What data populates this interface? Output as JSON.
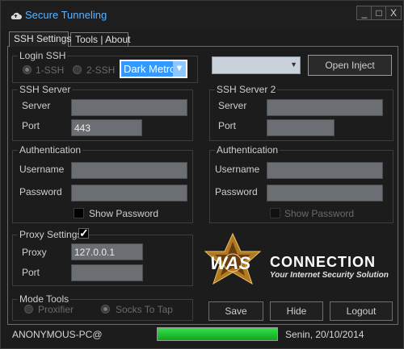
{
  "window": {
    "title": "Secure Tunneling",
    "minimize_label": "_",
    "maximize_label": "□",
    "close_label": "X"
  },
  "tabs": [
    {
      "label": "SSH Settings",
      "active": true
    },
    {
      "label": "Tools | About",
      "active": false
    }
  ],
  "login_ssh": {
    "legend": "Login SSH",
    "option1": "1-SSH",
    "option2": "2-SSH",
    "theme_value": "Dark Metro"
  },
  "open_inject": {
    "dropdown_value": "",
    "button_label": "Open Inject"
  },
  "ssh_server": {
    "legend": "SSH Server",
    "server_label": "Server",
    "server_value": "",
    "port_label": "Port",
    "port_value": "443"
  },
  "ssh_server2": {
    "legend": "SSH Server 2",
    "server_label": "Server",
    "server_value": "",
    "port_label": "Port",
    "port_value": ""
  },
  "auth": {
    "legend": "Authentication",
    "username_label": "Username",
    "username_value": "",
    "password_label": "Password",
    "password_value": "",
    "show_password": "Show Password"
  },
  "auth2": {
    "legend": "Authentication",
    "username_label": "Username",
    "username_value": "",
    "password_label": "Password",
    "password_value": "",
    "show_password": "Show Password"
  },
  "proxy": {
    "legend": "Proxy Settings",
    "checked_glyph": "✓",
    "proxy_label": "Proxy",
    "proxy_value": "127.0.0.1",
    "port_label": "Port",
    "port_value": ""
  },
  "mode_tools": {
    "legend": "Mode Tools",
    "option1": "Proxifier",
    "option2": "Socks To Tap"
  },
  "logo": {
    "brand": "WAS",
    "word": "CONNECTION",
    "tagline": "Your Internet Security Solution",
    "emblem_text": "WAS CONNECTION"
  },
  "actions": {
    "save": "Save",
    "hide": "Hide",
    "logout": "Logout"
  },
  "status": {
    "computer": "ANONYMOUS-PC@",
    "progress": 1.0,
    "date": "Senin, 20/10/2014"
  },
  "colors": {
    "accent": "#5ab4ff",
    "theme_select": "#3399ff",
    "field": "#6b6f73",
    "progress": "#22c832"
  }
}
